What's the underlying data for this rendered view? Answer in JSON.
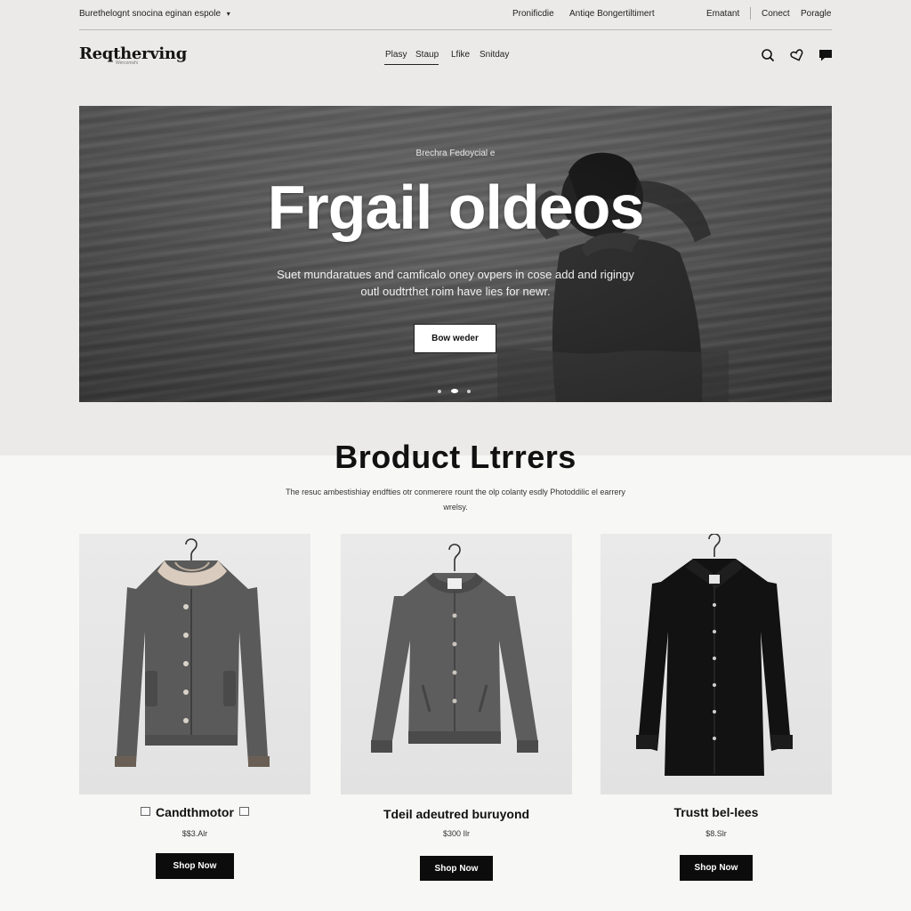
{
  "utility": {
    "promo": "Burethelognt snocina eginan espole",
    "promo_chevron": "chevron-down-icon",
    "links": [
      "Pronificdie",
      "Antiqe Bongertiltimert",
      "Ematant",
      "Conect",
      "Poragle"
    ]
  },
  "brand": {
    "logo": "Reqtherving",
    "logo_sub": "Wercomshi"
  },
  "nav": {
    "items": [
      "Plasy",
      "Staup",
      "Lfike",
      "Snitday"
    ],
    "icons": [
      "search-icon",
      "heart-icon",
      "chat-icon"
    ]
  },
  "hero": {
    "eyebrow": "Brechra Fedoycial e",
    "title": "Frgail oldeos",
    "description": "Suet mundaratues and camficalo oney ovpers in cose add and rigingy outl oudtrthet roim have lies for newr.",
    "cta": "Bow weder",
    "slides": 3,
    "active_slide": 2
  },
  "section": {
    "title": "Broduct Ltrrers",
    "description": "The resuc ambestishiay endfties otr conmerere rount the olp colanty esdly Photoddilic el earrery wrelsy."
  },
  "products": [
    {
      "name": "Candthmotor",
      "price": "$$3.Alr",
      "cta": "Shop Now",
      "garment": "sherpa-collar-jacket"
    },
    {
      "name": "Tdeil adeutred buruyond",
      "price": "$300 Ilr",
      "cta": "Shop Now",
      "garment": "bomber-jacket"
    },
    {
      "name": "Trustt bel-lees",
      "price": "$8.Slr",
      "cta": "Shop Now",
      "garment": "black-overshirt"
    }
  ],
  "colors": {
    "top_band": "#ebeae8",
    "page_bg": "#f7f7f6",
    "button_dark": "#0c0c0c",
    "text": "#111111"
  }
}
